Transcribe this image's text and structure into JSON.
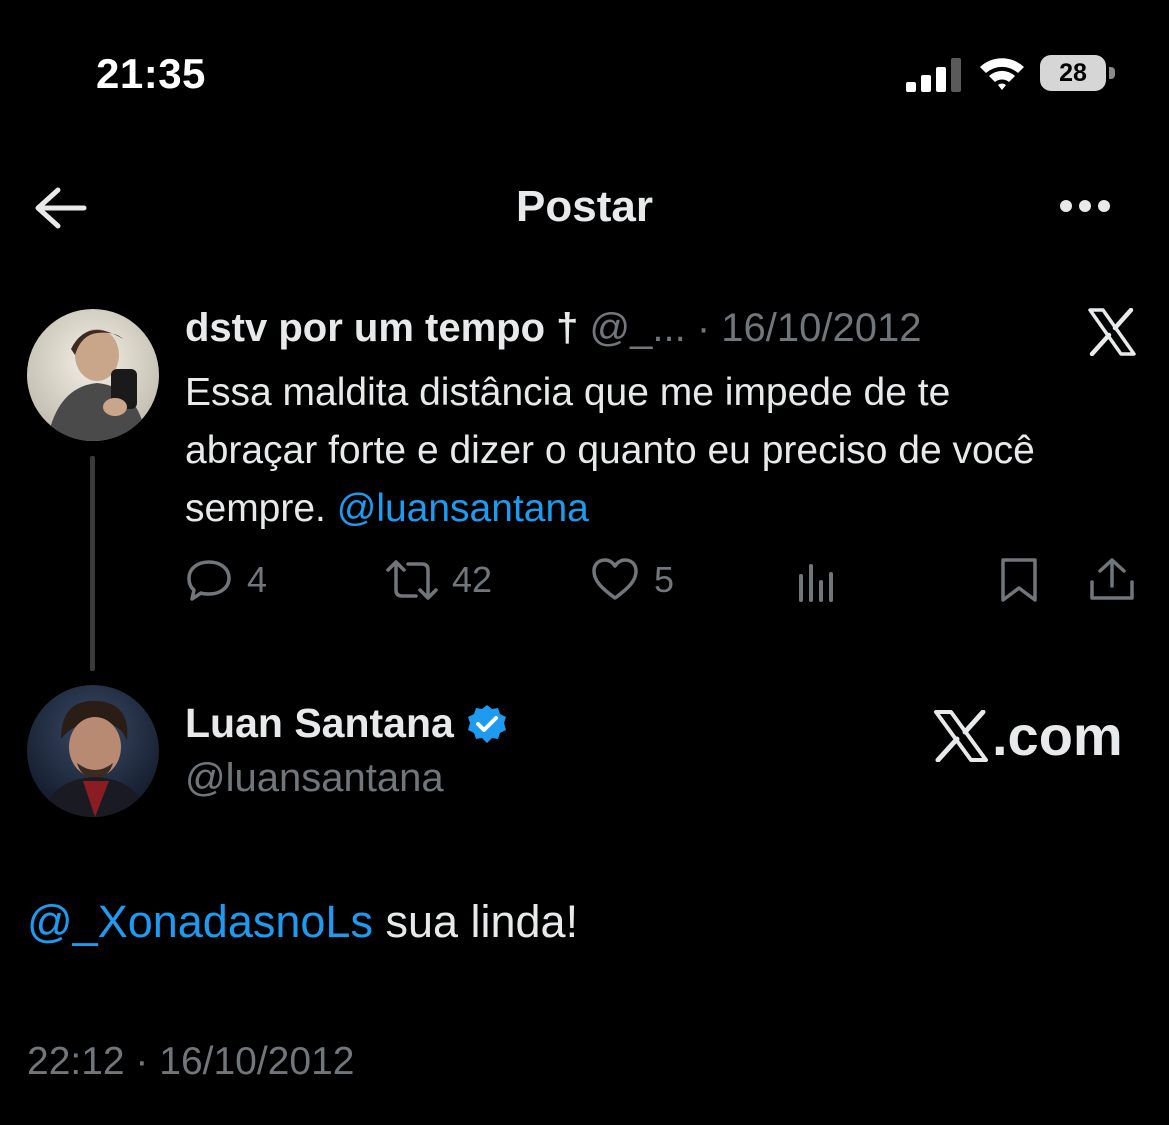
{
  "status_bar": {
    "time": "21:35",
    "battery": "28"
  },
  "header": {
    "title": "Postar"
  },
  "tweet1": {
    "display_name": "dstv por um tempo †",
    "handle": "@_...",
    "date": "· 16/10/2012",
    "text": "Essa maldita distância que me impede de te abraçar forte e dizer o quanto eu preciso de você sempre.",
    "mention": "@luansantana",
    "actions": {
      "replies": "4",
      "reposts": "42",
      "likes": "5"
    }
  },
  "tweet2": {
    "display_name": "Luan Santana",
    "handle": "@luansantana",
    "mention": "@_XonadasnoLs",
    "text": "sua linda!",
    "timestamp": "22:12 · 16/10/2012"
  },
  "watermark": {
    "domain": ".com"
  },
  "colors": {
    "accent": "#1d9bf0",
    "muted": "#71767b",
    "text": "#e7e9ea",
    "background": "#000000"
  },
  "icons": [
    "back-arrow-icon",
    "more-icon",
    "x-logo-icon",
    "reply-icon",
    "repost-icon",
    "like-icon",
    "views-icon",
    "bookmark-icon",
    "share-icon",
    "verified-icon",
    "cellular-signal-icon",
    "wifi-icon",
    "battery-icon"
  ]
}
